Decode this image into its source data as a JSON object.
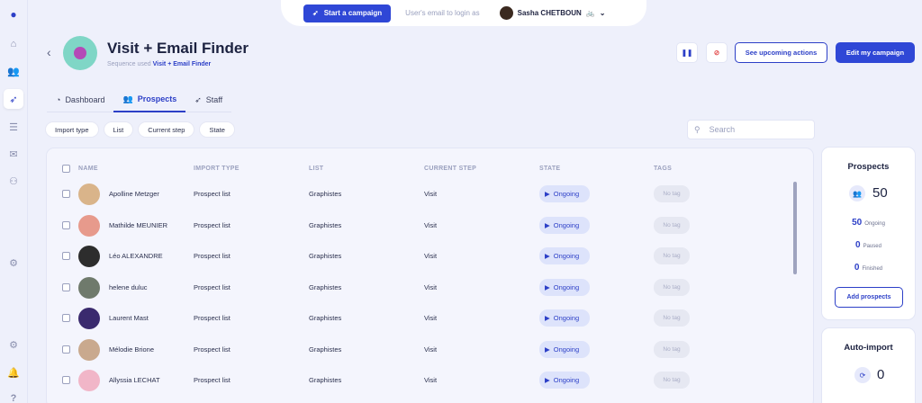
{
  "topbar": {
    "start_label": "Start a campaign",
    "login_hint": "User's email to login as",
    "user_name": "Sasha CHETBOUN"
  },
  "campaign": {
    "title": "Visit + Email Finder",
    "sequence_prefix": "Sequence used",
    "sequence_name": "Visit + Email Finder"
  },
  "actions": {
    "upcoming": "See upcoming actions",
    "edit": "Edit my campaign"
  },
  "tabs": [
    {
      "label": "Dashboard"
    },
    {
      "label": "Prospects"
    },
    {
      "label": "Staff"
    }
  ],
  "filters": [
    "Import type",
    "List",
    "Current step",
    "State"
  ],
  "search": {
    "placeholder": "Search"
  },
  "table": {
    "headers": [
      "NAME",
      "IMPORT TYPE",
      "LIST",
      "CURRENT STEP",
      "STATE",
      "TAGS"
    ],
    "rows": [
      {
        "name": "Apolline Metzger",
        "import_type": "Prospect list",
        "list": "Graphistes",
        "step": "Visit",
        "state": "Ongoing",
        "tag": "No tag",
        "avatar_color": "#d9b48a"
      },
      {
        "name": "Mathilde MEUNIER",
        "import_type": "Prospect list",
        "list": "Graphistes",
        "step": "Visit",
        "state": "Ongoing",
        "tag": "No tag",
        "avatar_color": "#e79a8c"
      },
      {
        "name": "Léo ALEXANDRE",
        "import_type": "Prospect list",
        "list": "Graphistes",
        "step": "Visit",
        "state": "Ongoing",
        "tag": "No tag",
        "avatar_color": "#2d2d2d"
      },
      {
        "name": "helene duluc",
        "import_type": "Prospect list",
        "list": "Graphistes",
        "step": "Visit",
        "state": "Ongoing",
        "tag": "No tag",
        "avatar_color": "#6f7a6c"
      },
      {
        "name": "Laurent Mast",
        "import_type": "Prospect list",
        "list": "Graphistes",
        "step": "Visit",
        "state": "Ongoing",
        "tag": "No tag",
        "avatar_color": "#3a2a6e"
      },
      {
        "name": "Mélodie Brione",
        "import_type": "Prospect list",
        "list": "Graphistes",
        "step": "Visit",
        "state": "Ongoing",
        "tag": "No tag",
        "avatar_color": "#c9a98e"
      },
      {
        "name": "Allyssia LECHAT",
        "import_type": "Prospect list",
        "list": "Graphistes",
        "step": "Visit",
        "state": "Ongoing",
        "tag": "No tag",
        "avatar_color": "#f1b6c8"
      }
    ]
  },
  "prospects_card": {
    "title": "Prospects",
    "total": "50",
    "stats": [
      {
        "n": "50",
        "label": "Ongoing"
      },
      {
        "n": "0",
        "label": "Paused"
      },
      {
        "n": "0",
        "label": "Finished"
      }
    ],
    "add_label": "Add prospects"
  },
  "autoimport_card": {
    "title": "Auto-import",
    "total": "0"
  },
  "icons": {
    "sidebar": [
      "logo-icon",
      "home-icon",
      "users-icon",
      "rocket-icon",
      "list-icon",
      "chat-icon",
      "team-icon",
      "settings-icon",
      "gear-icon",
      "bell-icon",
      "help-icon"
    ]
  }
}
